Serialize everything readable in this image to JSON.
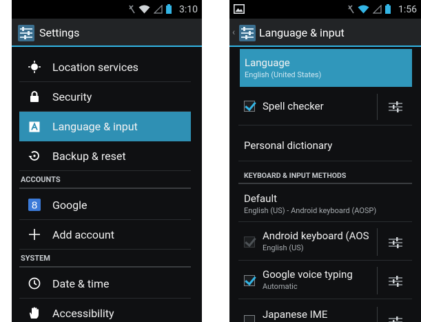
{
  "left": {
    "status": {
      "time": "3:10"
    },
    "actionbar": {
      "title": "Settings"
    },
    "items": [
      {
        "label": "Location services",
        "icon": "location-icon"
      },
      {
        "label": "Security",
        "icon": "lock-icon"
      },
      {
        "label": "Language & input",
        "icon": "keyboard-a-icon",
        "selected": true
      },
      {
        "label": "Backup & reset",
        "icon": "backup-icon"
      }
    ],
    "section_accounts": "ACCOUNTS",
    "accounts": [
      {
        "label": "Google",
        "icon": "google-icon"
      },
      {
        "label": "Add account",
        "icon": "plus-icon"
      }
    ],
    "section_system": "SYSTEM",
    "system": [
      {
        "label": "Date & time",
        "icon": "clock-icon"
      },
      {
        "label": "Accessibility",
        "icon": "hand-icon"
      }
    ]
  },
  "right": {
    "status": {
      "time": "1:56"
    },
    "actionbar": {
      "title": "Language & input"
    },
    "language": {
      "title": "Language",
      "subtitle": "English (United States)"
    },
    "spell": {
      "title": "Spell checker"
    },
    "dictionary": {
      "title": "Personal dictionary"
    },
    "section_keyboard": "KEYBOARD & INPUT METHODS",
    "default_method": {
      "title": "Default",
      "subtitle": "English (US) - Android keyboard (AOSP)"
    },
    "methods": [
      {
        "title": "Android keyboard (AOS",
        "subtitle": "English (US)",
        "checked": true,
        "disabled": true
      },
      {
        "title": "Google voice typing",
        "subtitle": "Automatic",
        "checked": true,
        "disabled": false
      },
      {
        "title": "Japanese IME",
        "subtitle": "",
        "checked": false,
        "disabled": false
      }
    ]
  },
  "colors": {
    "accent": "#33b5e5",
    "selection": "#3097bb",
    "background": "#0f1012"
  }
}
